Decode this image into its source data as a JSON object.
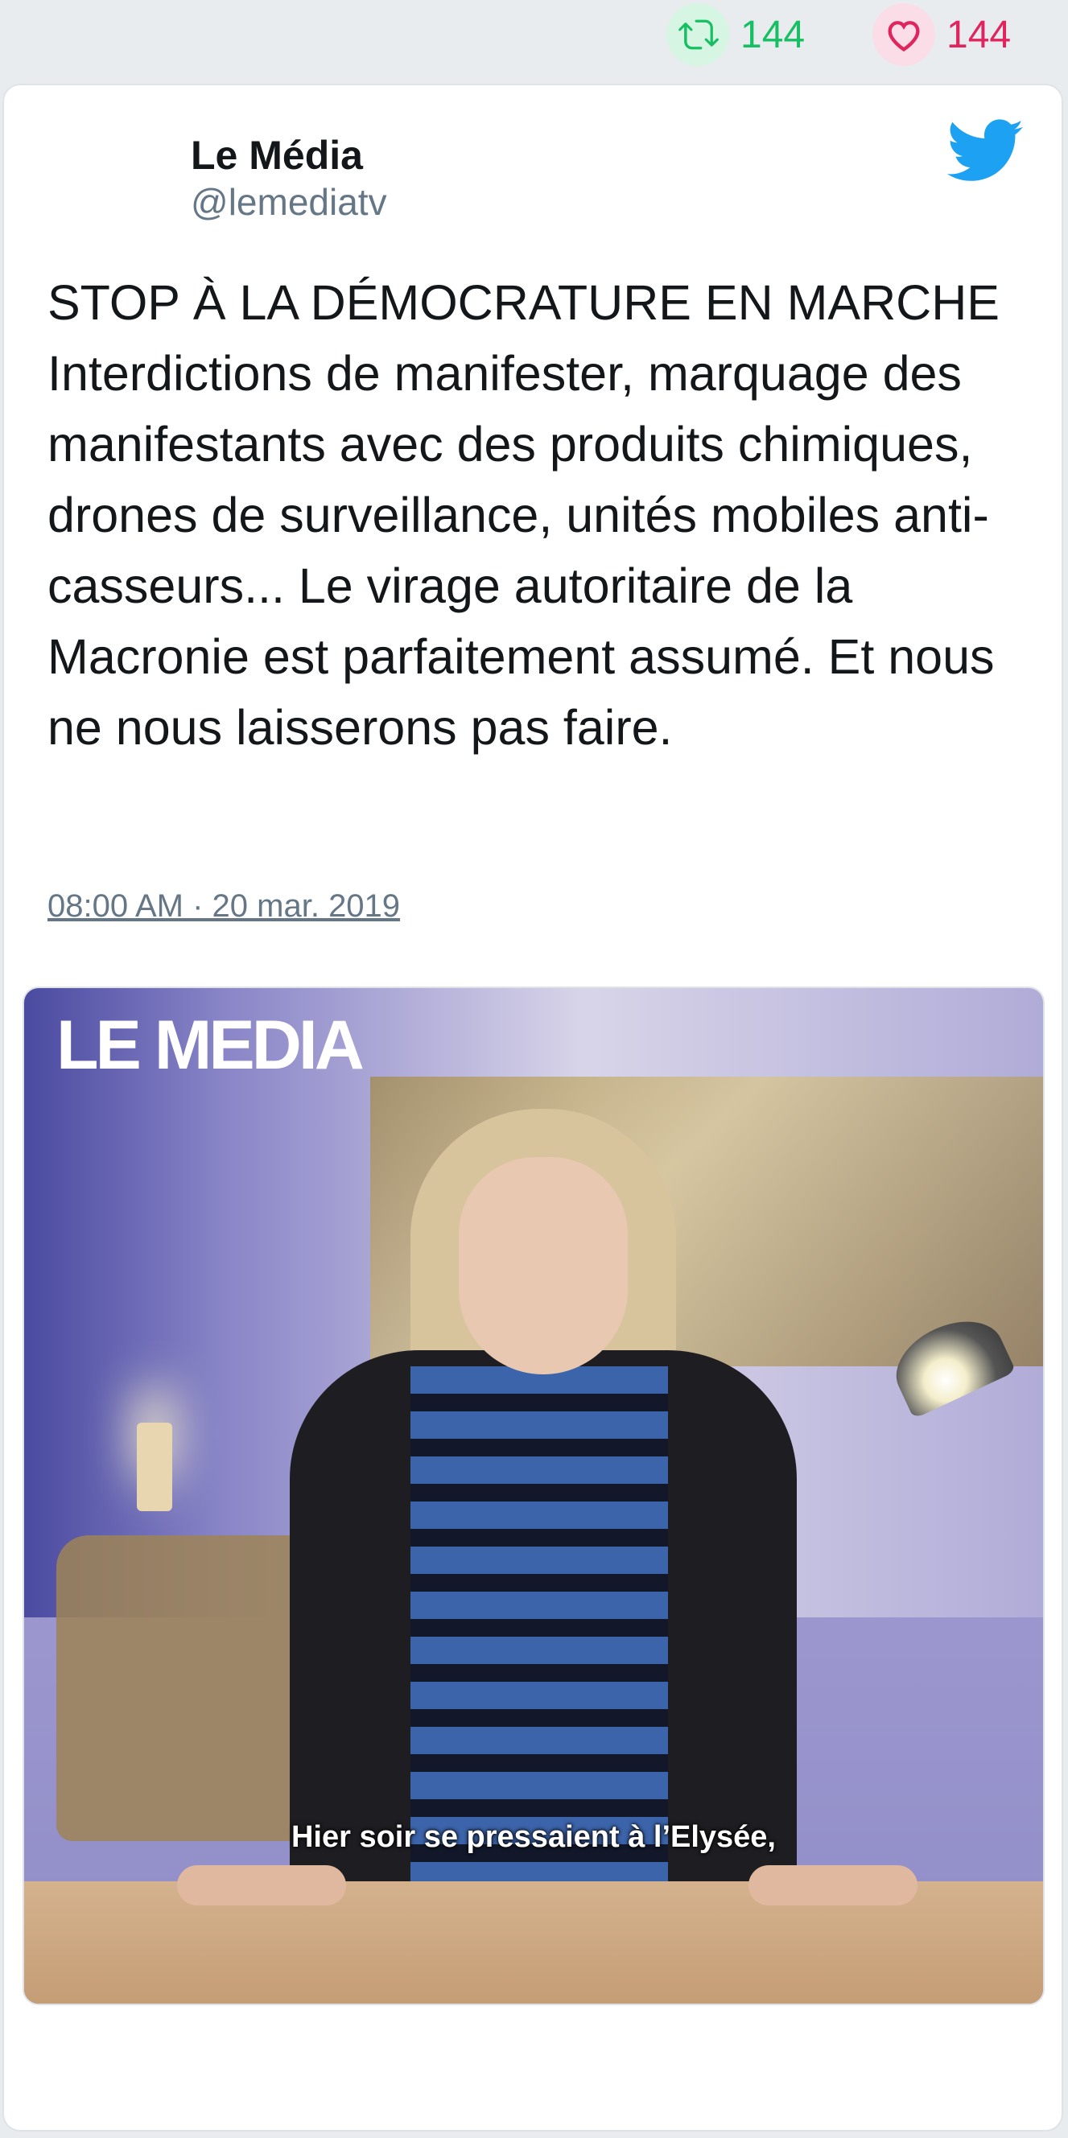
{
  "stats": {
    "retweet_count": "144",
    "like_count": "144"
  },
  "tweet": {
    "author_name": "Le Média",
    "author_handle": "@lemediatv",
    "text": "STOP À LA DÉMOCRATURE EN MARCHE Interdictions de manifester, marquage des manifestants avec des produits chimiques, drones de surveillance, unités mobiles anti-casseurs... Le virage autoritaire de la Macronie est parfaitement assumé. Et nous ne nous laisserons pas faire.",
    "timestamp": "08:00 AM · 20 mar. 2019"
  },
  "media": {
    "logo_text": "LE MEDIA",
    "subtitle": "Hier soir se pressaient à l’Elysée,"
  },
  "icons": {
    "retweet": "retweet-icon",
    "like": "heart-icon",
    "reply": "reply-icon",
    "brand": "twitter-bird-icon"
  },
  "colors": {
    "retweet": "#17bf63",
    "like": "#e0245e",
    "brand": "#1da1f2",
    "muted": "#657786"
  }
}
